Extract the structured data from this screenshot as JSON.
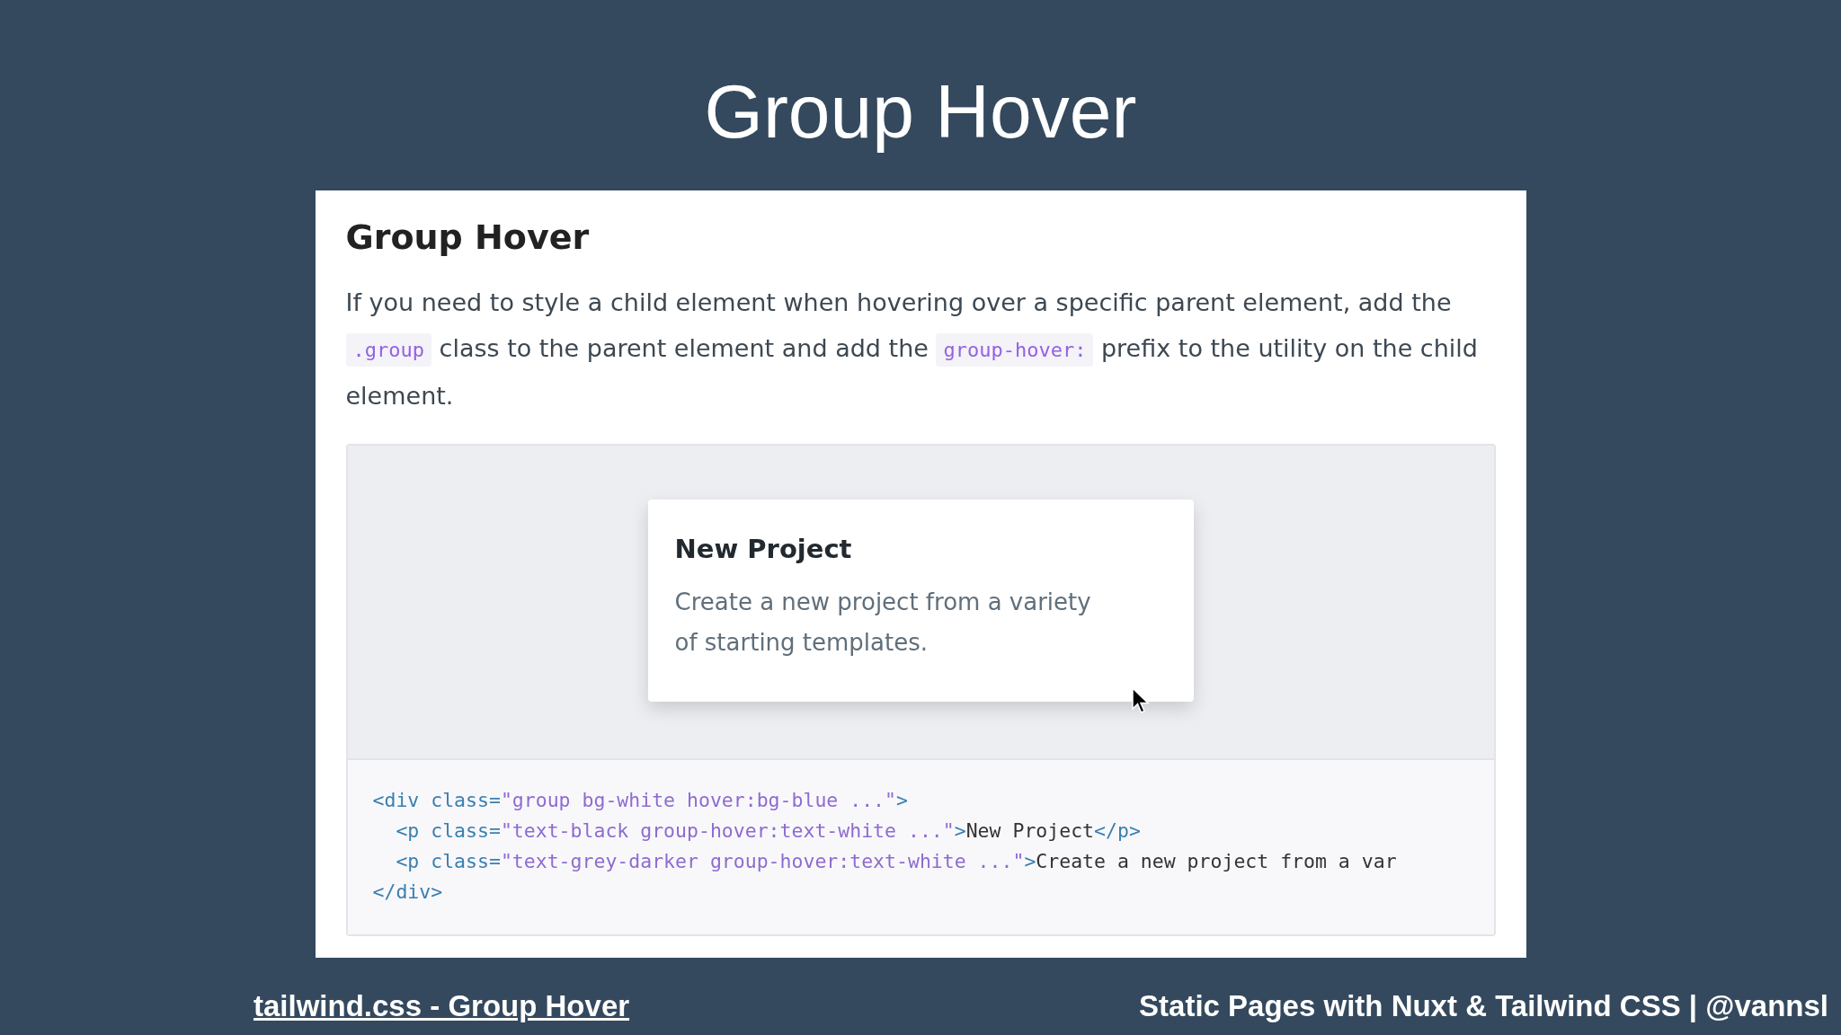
{
  "slide_title": "Group Hover",
  "page": {
    "heading": "Group Hover",
    "paragraph": [
      {
        "kind": "text",
        "text": "If you need to style a child element when hovering over a specific parent element, add the "
      },
      {
        "kind": "code",
        "text": ".group"
      },
      {
        "kind": "text",
        "text": " class to the parent element and add the "
      },
      {
        "kind": "code",
        "text": "group-hover:"
      },
      {
        "kind": "text",
        "text": " prefix to the utility on the child element."
      }
    ],
    "demo_card": {
      "title": "New Project",
      "description": "Create a new project from a variety of starting templates."
    },
    "code_lines": [
      [
        {
          "kind": "tag",
          "text": "<div class="
        },
        {
          "kind": "value",
          "text": "\"group bg-white hover:bg-blue ...\""
        },
        {
          "kind": "tag",
          "text": ">"
        }
      ],
      [
        {
          "kind": "tag",
          "text": "  <p class="
        },
        {
          "kind": "value",
          "text": "\"text-black group-hover:text-white ...\""
        },
        {
          "kind": "tag",
          "text": ">"
        },
        {
          "kind": "text",
          "text": "New Project"
        },
        {
          "kind": "tag",
          "text": "</p>"
        }
      ],
      [
        {
          "kind": "tag",
          "text": "  <p class="
        },
        {
          "kind": "value",
          "text": "\"text-grey-darker group-hover:text-white ...\""
        },
        {
          "kind": "tag",
          "text": ">"
        },
        {
          "kind": "text",
          "text": "Create a new project from a var"
        }
      ],
      [
        {
          "kind": "tag",
          "text": "</div>"
        }
      ]
    ]
  },
  "footer": {
    "link": "tailwind.css - Group Hover",
    "credit": "Static Pages with Nuxt & Tailwind CSS | @vannsl"
  }
}
